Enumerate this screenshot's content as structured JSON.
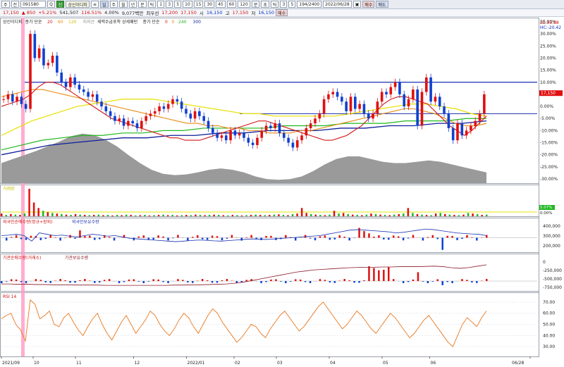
{
  "toolbar": {
    "items": [
      "주",
      "전",
      "091580",
      "Q",
      "신",
      "상신이디피",
      "≡",
      "일",
      "주",
      "월",
      "년",
      "분",
      "틱",
      "1",
      "3",
      "5",
      "10",
      "15",
      "30",
      "45",
      "60",
      "120",
      "분",
      "초",
      "틱",
      "3",
      "5",
      "194/2400",
      "2022/06/28",
      "▣",
      "매수",
      "매도"
    ]
  },
  "infobar": {
    "price": "17,150",
    "change": "▲ 850",
    "rate": "+5.21%",
    "volume": "541,507",
    "vol_rate": "116.51%",
    "turnover": "4.00%",
    "amount": "9,077백만",
    "pref": "최우선",
    "best": "17,200",
    "best2": "17,150",
    "open_label": "시",
    "open": "16,150",
    "high_label": "고",
    "high": "17,150",
    "low_label": "저",
    "low": "16,150",
    "buy": "매수"
  },
  "panels": {
    "main_legend": {
      "name": "상신이디피",
      "ma": "종가 단순",
      "p20": "20",
      "p60": "60",
      "p120": "120",
      "band": "지지선",
      "strategy": "세력수급포착 상세패턴",
      "ma2": "종가 단순",
      "p0a": "0",
      "p0b": "0",
      "p240": "240",
      "p300": "300"
    },
    "lc": "LC:35.98",
    "hc": "HC:-20.42",
    "price_tag": "17,150",
    "vol_label": "거래량",
    "vol_pct": "5.07%",
    "vol_pct2": "0.00%",
    "foreign_legend": "외국인순매수량(정규+장외)",
    "foreign_legend2": "외국인보유수량",
    "inst_legend": "기관순매수량(거래소)",
    "inst_legend2": "기관보유수량",
    "rsi_legend": "RSI 14",
    "rsi_pct_ticks": [
      "70.00",
      "60.00",
      "50.00",
      "40.00",
      "30.00"
    ]
  },
  "axis": {
    "price_pct": [
      "35.00%",
      "30.00%",
      "25.00%",
      "20.00%",
      "15.00%",
      "10.00%",
      "5.00%",
      "0.00%",
      "-5.00%",
      "-10.00%",
      "-15.00%",
      "-20.00%",
      "-25.00%",
      "-30.00%"
    ],
    "foreign": [
      "400,000",
      "300,000",
      "200,000"
    ],
    "inst": [
      "0",
      "-250,000",
      "-500,000",
      "-750,000"
    ],
    "rsi": [
      "70.00",
      "60.00",
      "50.00",
      "40.00",
      "30.00"
    ],
    "dates": [
      "2021/09",
      "10",
      "11",
      "12",
      "2022/01",
      "02",
      "03",
      "04",
      "05",
      "06",
      "06/28"
    ]
  },
  "chart_data": {
    "type": "candlestick",
    "price_range_pct": [
      -30,
      35
    ],
    "hlines_pct": [
      10,
      -3
    ],
    "candles_pct": [
      3,
      5,
      2,
      4,
      1,
      -1,
      30,
      20,
      24,
      17,
      18,
      21,
      14,
      10,
      8,
      12,
      9,
      7,
      6,
      4,
      5,
      2,
      0,
      -2,
      -4,
      -6,
      -5,
      -8,
      -6,
      -7,
      -9,
      -6,
      -4,
      -3,
      -2,
      0,
      -1,
      1,
      3,
      2,
      -1,
      -3,
      -5,
      -2,
      -4,
      -6,
      -9,
      -11,
      -13,
      -12,
      -14,
      -10,
      -12,
      -11,
      -13,
      -15,
      -16,
      -13,
      -10,
      -8,
      -9,
      -7,
      -11,
      -13,
      -15,
      -17,
      -14,
      -12,
      -9,
      -7,
      -5,
      -3,
      3,
      5,
      6,
      4,
      2,
      -2,
      4,
      -1,
      1,
      -3,
      -5,
      -3,
      2,
      6,
      5,
      8,
      10,
      5,
      0,
      3,
      7,
      -8,
      6,
      12,
      2,
      4,
      0,
      -3,
      -9,
      -14,
      -7,
      -12,
      -10,
      -8,
      -6,
      -3,
      5
    ],
    "ma20_pct": [
      0,
      1,
      2,
      3,
      5,
      8,
      10,
      10,
      9,
      7,
      5,
      3,
      1,
      -1,
      -3,
      -5,
      -6,
      -7,
      -8,
      -9,
      -10,
      -11,
      -12,
      -13,
      -13,
      -14,
      -14,
      -14,
      -13,
      -12,
      -11,
      -10,
      -9,
      -8,
      -7,
      -6,
      -6,
      -7,
      -8,
      -9,
      -10,
      -11,
      -12,
      -13,
      -14,
      -14,
      -13,
      -12,
      -10,
      -8,
      -5,
      -2,
      1,
      3,
      4,
      4,
      3,
      2,
      1,
      -2,
      -5,
      -8,
      -10,
      -12,
      -10,
      -7,
      -4
    ],
    "ma60_pct": [
      4,
      5,
      6,
      7,
      7,
      6,
      5,
      4,
      3,
      2,
      1,
      0,
      -1,
      -2,
      -3,
      -4,
      -5,
      -6,
      -7,
      -7,
      -8,
      -8,
      -9,
      -9,
      -10,
      -10,
      -11,
      -11,
      -11,
      -10,
      -10,
      -9,
      -8,
      -7,
      -6,
      -5,
      -4,
      -3,
      -2,
      -1,
      -1,
      -2,
      -3,
      -5,
      -7,
      -8,
      -8,
      -7
    ],
    "ma120_pct": [
      -12,
      -9,
      -6,
      -4,
      -2,
      0,
      1,
      2,
      3,
      3,
      3,
      2,
      1,
      0,
      -1,
      -2,
      -3,
      -3,
      -4,
      -4,
      -4,
      -4,
      -4,
      -3,
      -2,
      -1,
      0,
      1,
      1,
      0,
      -1,
      -3,
      -4
    ],
    "ma240_pct": [
      -18,
      -16,
      -14,
      -13,
      -12,
      -12,
      -11,
      -11,
      -10,
      -10,
      -9,
      -9,
      -9,
      -9,
      -8,
      -8,
      -8,
      -7,
      -7,
      -7,
      -6,
      -6,
      -6,
      -5,
      -5
    ],
    "ma300_pct": [
      -20,
      -18,
      -16,
      -15,
      -14,
      -13,
      -13,
      -12,
      -12,
      -11,
      -11,
      -10,
      -10,
      -10,
      -9,
      -9,
      -8,
      -8,
      -7,
      -7,
      -6
    ],
    "vol_profile": [
      0.3,
      0.36,
      0.42,
      0.48,
      0.55,
      0.62,
      0.7,
      0.74,
      0.72,
      0.65,
      0.55,
      0.42,
      0.3,
      0.2,
      0.14,
      0.12,
      0.13,
      0.16,
      0.2,
      0.22,
      0.2,
      0.16,
      0.1,
      0.06,
      0.05,
      0.06,
      0.1,
      0.18,
      0.28,
      0.36,
      0.4,
      0.4,
      0.36,
      0.32,
      0.3,
      0.3,
      0.32,
      0.34,
      0.32,
      0.28,
      0.24,
      0.2,
      0.16
    ],
    "volume": [
      0.1,
      0.05,
      0.08,
      0.06,
      0.05,
      0.1,
      1.0,
      0.5,
      0.3,
      0.2,
      0.15,
      0.12,
      0.1,
      0.08,
      0.06,
      0.05,
      0.08,
      0.06,
      0.05,
      0.04,
      0.05,
      0.06,
      0.04,
      0.05,
      0.03,
      0.05,
      0.04,
      0.06,
      0.05,
      0.03,
      0.04,
      0.05,
      0.03,
      0.04,
      0.05,
      0.06,
      0.04,
      0.05,
      0.03,
      0.04,
      0.05,
      0.04,
      0.06,
      0.05,
      0.04,
      0.05,
      0.06,
      0.05,
      0.04,
      0.03,
      0.05,
      0.04,
      0.03,
      0.04,
      0.05,
      0.06,
      0.05,
      0.04,
      0.05,
      0.06,
      0.07,
      0.05,
      0.04,
      0.08,
      0.1,
      0.3,
      0.12,
      0.08,
      0.06,
      0.05,
      0.04,
      0.06,
      0.2,
      0.1,
      0.12,
      0.08,
      0.06,
      0.05,
      0.04,
      0.06,
      0.1,
      0.08,
      0.06,
      0.05,
      0.04,
      0.06,
      0.08,
      0.1,
      0.3,
      0.12,
      0.08,
      0.06,
      0.05,
      0.04,
      0.1,
      0.12,
      0.08,
      0.06,
      0.05,
      0.04,
      0.06,
      0.12,
      0.1,
      0.08,
      0.05,
      0.06
    ],
    "foreign_line": [
      0.5,
      0.52,
      0.55,
      0.5,
      0.3,
      0.6,
      0.55,
      0.5,
      0.52,
      0.48,
      0.45,
      0.5,
      0.55,
      0.52,
      0.48,
      0.5,
      0.45,
      0.4,
      0.38,
      0.36,
      0.34,
      0.32,
      0.3,
      0.28,
      0.3,
      0.32,
      0.34,
      0.33,
      0.31,
      0.3,
      0.32,
      0.34,
      0.36,
      0.38,
      0.37,
      0.36,
      0.38,
      0.4,
      0.42,
      0.44,
      0.46,
      0.48,
      0.5,
      0.55,
      0.6,
      0.65,
      0.7,
      0.72,
      0.7,
      0.68,
      0.66,
      0.64,
      0.6,
      0.62,
      0.66,
      0.7,
      0.74,
      0.72,
      0.68,
      0.64,
      0.6,
      0.58,
      0.56,
      0.55,
      0.5
    ],
    "inst_line": [
      0.15,
      0.15,
      0.14,
      0.14,
      0.13,
      0.13,
      0.12,
      0.12,
      0.12,
      0.11,
      0.11,
      0.11,
      0.1,
      0.1,
      0.1,
      0.1,
      0.1,
      0.1,
      0.1,
      0.1,
      0.11,
      0.11,
      0.12,
      0.12,
      0.13,
      0.14,
      0.15,
      0.18,
      0.22,
      0.28,
      0.34,
      0.4,
      0.46,
      0.52,
      0.58,
      0.62,
      0.66,
      0.68,
      0.7,
      0.72,
      0.74,
      0.75,
      0.76,
      0.76,
      0.77,
      0.77,
      0.78,
      0.78,
      0.78,
      0.79,
      0.8,
      0.78,
      0.74,
      0.72,
      0.75,
      0.8,
      0.85
    ],
    "rsi": [
      55,
      58,
      60,
      50,
      45,
      35,
      72,
      68,
      55,
      58,
      62,
      50,
      48,
      56,
      60,
      52,
      45,
      40,
      48,
      55,
      60,
      50,
      42,
      36,
      44,
      52,
      58,
      50,
      42,
      48,
      54,
      62,
      58,
      50,
      44,
      40,
      46,
      54,
      60,
      56,
      48,
      42,
      50,
      58,
      64,
      60,
      52,
      46,
      40,
      34,
      38,
      44,
      50,
      48,
      42,
      38,
      46,
      52,
      58,
      62,
      56,
      50,
      44,
      48,
      54,
      60,
      66,
      70,
      64,
      58,
      52,
      46,
      50,
      56,
      62,
      58,
      52,
      46,
      42,
      48,
      54,
      60,
      56,
      50,
      44,
      38,
      42,
      48,
      54,
      58,
      52,
      46,
      40,
      34,
      30,
      40,
      50,
      56,
      52,
      48,
      56,
      62
    ],
    "x_ticks": [
      "2021/09",
      "10",
      "11",
      "12",
      "2022/01",
      "02",
      "03",
      "04",
      "05",
      "06",
      "06/28"
    ],
    "x_tick_positions": [
      0.0,
      0.06,
      0.14,
      0.25,
      0.35,
      0.44,
      0.52,
      0.62,
      0.72,
      0.81,
      1.0
    ]
  }
}
